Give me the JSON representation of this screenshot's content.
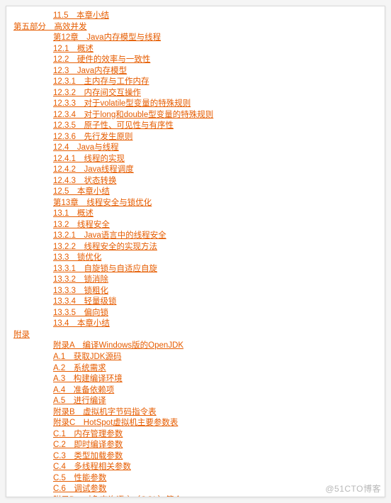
{
  "watermark": "@51CTO博客",
  "items": [
    {
      "lvl": 3,
      "text": "11.5　本章小结"
    },
    {
      "lvl": 1,
      "text": "第五部分　高效并发",
      "part": true
    },
    {
      "lvl": 3,
      "text": "第12章　Java内存模型与线程"
    },
    {
      "lvl": 3,
      "text": "12.1　概述"
    },
    {
      "lvl": 3,
      "text": "12.2　硬件的效率与一致性"
    },
    {
      "lvl": 3,
      "text": "12.3　Java内存模型"
    },
    {
      "lvl": 3,
      "text": "12.3.1　主内存与工作内存"
    },
    {
      "lvl": 3,
      "text": "12.3.2　内存间交互操作"
    },
    {
      "lvl": 3,
      "text": "12.3.3　对于volatile型变量的特殊规则"
    },
    {
      "lvl": 3,
      "text": "12.3.4　对于long和double型变量的特殊规则"
    },
    {
      "lvl": 3,
      "text": "12.3.5　原子性、可见性与有序性"
    },
    {
      "lvl": 3,
      "text": "12.3.6　先行发生原则"
    },
    {
      "lvl": 3,
      "text": "12.4　Java与线程"
    },
    {
      "lvl": 3,
      "text": "12.4.1　线程的实现"
    },
    {
      "lvl": 3,
      "text": "12.4.2　Java线程调度"
    },
    {
      "lvl": 3,
      "text": "12.4.3　状态转换"
    },
    {
      "lvl": 3,
      "text": "12.5　本章小结"
    },
    {
      "lvl": 3,
      "text": "第13章　线程安全与锁优化"
    },
    {
      "lvl": 3,
      "text": "13.1　概述"
    },
    {
      "lvl": 3,
      "text": "13.2　线程安全"
    },
    {
      "lvl": 3,
      "text": "13.2.1　Java语言中的线程安全"
    },
    {
      "lvl": 3,
      "text": "13.2.2　线程安全的实现方法"
    },
    {
      "lvl": 3,
      "text": "13.3　锁优化"
    },
    {
      "lvl": 3,
      "text": "13.3.1　自旋锁与自适应自旋"
    },
    {
      "lvl": 3,
      "text": "13.3.2　锁消除"
    },
    {
      "lvl": 3,
      "text": "13.3.3　锁粗化"
    },
    {
      "lvl": 3,
      "text": "13.3.4　轻量级锁"
    },
    {
      "lvl": 3,
      "text": "13.3.5　偏向锁"
    },
    {
      "lvl": 3,
      "text": "13.4　本章小结"
    },
    {
      "lvl": 1,
      "text": "附录",
      "part": true
    },
    {
      "lvl": 3,
      "text": "附录A　编译Windows版的OpenJDK"
    },
    {
      "lvl": 3,
      "text": "A.1　获取JDK源码"
    },
    {
      "lvl": 3,
      "text": "A.2　系统需求"
    },
    {
      "lvl": 3,
      "text": "A.3　构建编译环境"
    },
    {
      "lvl": 3,
      "text": "A.4　准备依赖项"
    },
    {
      "lvl": 3,
      "text": "A.5　进行编译"
    },
    {
      "lvl": 3,
      "text": "附录B　虚拟机字节码指令表"
    },
    {
      "lvl": 3,
      "text": "附录C　HotSpot虚拟机主要参数表"
    },
    {
      "lvl": 3,
      "text": "C.1　内存管理参数"
    },
    {
      "lvl": 3,
      "text": "C.2　即时编译参数"
    },
    {
      "lvl": 3,
      "text": "C.3　类型加载参数"
    },
    {
      "lvl": 3,
      "text": "C.4　多线程相关参数"
    },
    {
      "lvl": 3,
      "text": "C.5　性能参数"
    },
    {
      "lvl": 3,
      "text": "C.6　调试参数"
    },
    {
      "lvl": 3,
      "text": "附录D　对象查询语言（OQL）简介"
    }
  ]
}
